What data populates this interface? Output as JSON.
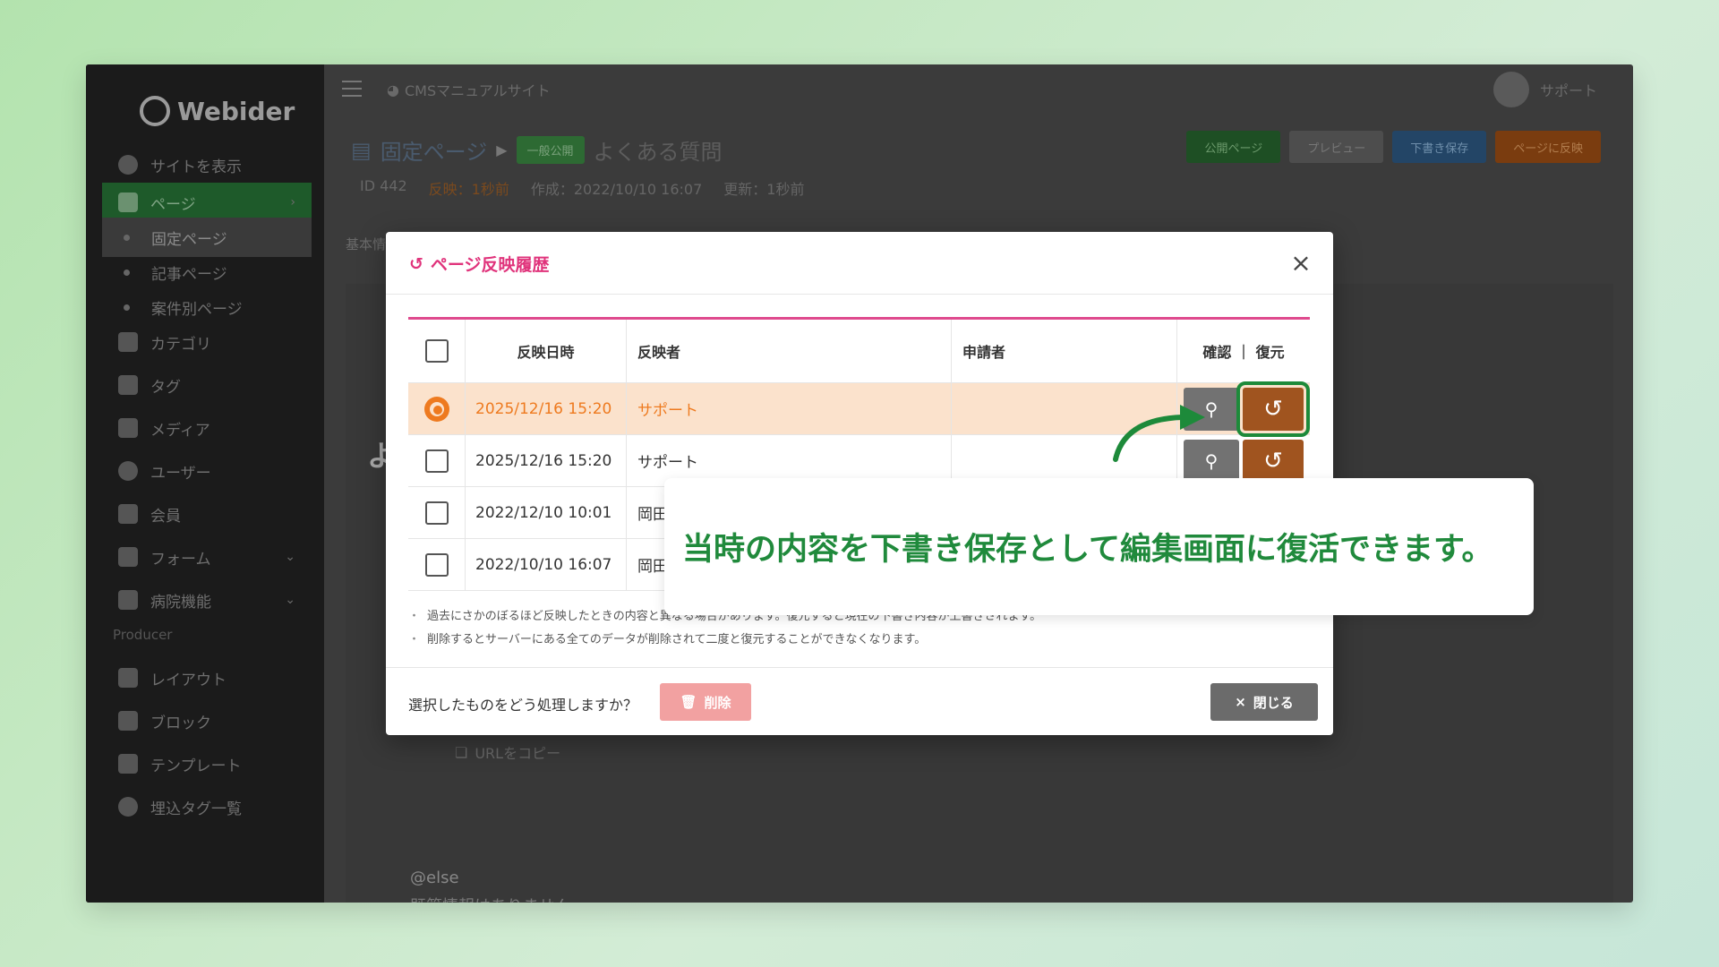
{
  "app": {
    "logo": "Webider",
    "breadcrumb": "CMSマニュアルサイト",
    "user": "サポート"
  },
  "sidebar": {
    "items": [
      {
        "label": "サイトを表示",
        "icon": "globe-icon"
      },
      {
        "label": "ページ",
        "icon": "page-icon"
      },
      {
        "label": "固定ページ"
      },
      {
        "label": "記事ページ"
      },
      {
        "label": "案件別ページ"
      },
      {
        "label": "カテゴリ",
        "icon": "category-icon"
      },
      {
        "label": "タグ",
        "icon": "tag-icon"
      },
      {
        "label": "メディア",
        "icon": "folder-icon"
      },
      {
        "label": "ユーザー",
        "icon": "user-icon"
      },
      {
        "label": "会員",
        "icon": "member-icon"
      },
      {
        "label": "フォーム",
        "icon": "send-icon"
      },
      {
        "label": "病院機能",
        "icon": "clipboard-icon"
      },
      {
        "label": "レイアウト",
        "icon": "layout-icon"
      },
      {
        "label": "ブロック",
        "icon": "blocks-icon"
      },
      {
        "label": "テンプレート",
        "icon": "monitor-icon"
      },
      {
        "label": "埋込タグ一覧",
        "icon": "at-icon"
      }
    ],
    "section": "Producer"
  },
  "page": {
    "crumb": "固定ページ",
    "status_badge": "一般公開",
    "title": "よくある質問",
    "id": "ID 442",
    "reflected": "反映：1秒前",
    "created": "作成：2022/10/10 16:07",
    "updated": "更新：1秒前",
    "tab": "基本情",
    "copy_url": "URLをコピー",
    "editor_line1": "@else",
    "editor_line2": "既第情報はありません",
    "bg_char": "よ"
  },
  "top_actions": {
    "public": "公開ページ",
    "preview": "プレビュー",
    "draft": "下書き保存",
    "publish": "ページに反映"
  },
  "modal": {
    "title": "ページ反映履歴",
    "columns": {
      "date": "反映日時",
      "user": "反映者",
      "applicant": "申請者",
      "actions": "確認 ｜ 復元"
    },
    "rows": [
      {
        "date": "2025/12/16 15:20",
        "user": "サポート",
        "applicant": ""
      },
      {
        "date": "2025/12/16 15:20",
        "user": "サポート",
        "applicant": ""
      },
      {
        "date": "2022/12/10 10:01",
        "user": "岡田",
        "applicant": ""
      },
      {
        "date": "2022/10/10 16:07",
        "user": "岡田",
        "applicant": ""
      }
    ],
    "notes": [
      "過去にさかのぼるほど反映したときの内容と異なる場合があります。復元すると現在の下書き内容が上書きされます。",
      "削除するとサーバーにある全てのデータが削除されて二度と復元することができなくなります。"
    ],
    "footer_question": "選択したものをどう処理しますか？",
    "delete_label": "削除",
    "close_label": "閉じる"
  },
  "callout": {
    "text": "当時の内容を下書き保存として編集画面に復活できます。"
  },
  "colors": {
    "accent_pink": "#e0337b",
    "highlight_row": "#fbe2cc",
    "restore_brown": "#a0541f",
    "callout_green": "#208a3c"
  }
}
